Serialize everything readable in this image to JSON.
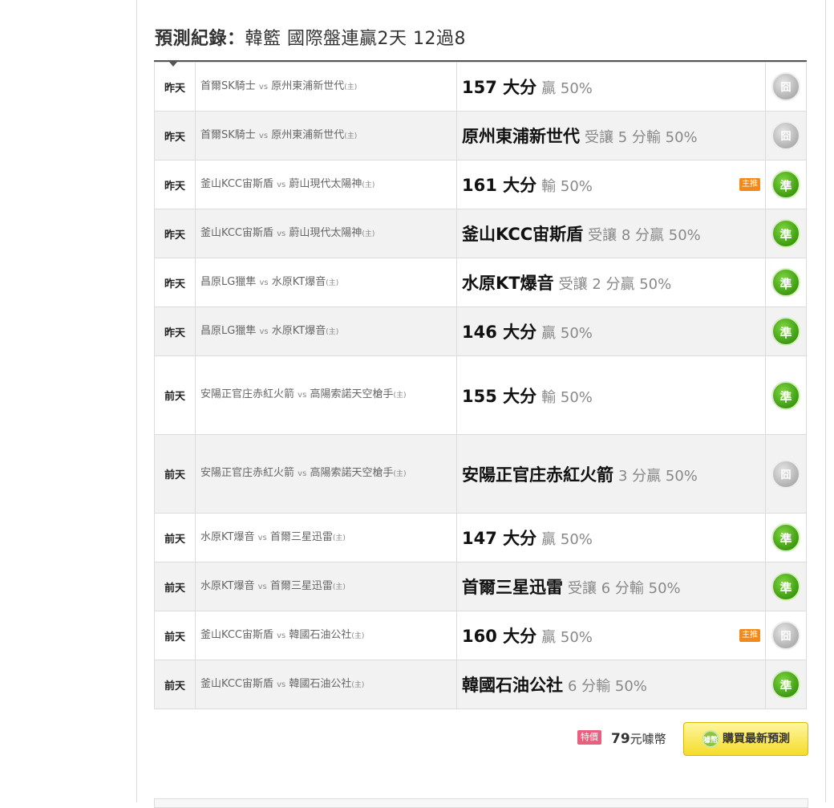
{
  "heading": {
    "prefix": "預測紀錄：",
    "rest": "韓籃 國際盤連贏2天 12過8"
  },
  "rows": [
    {
      "day": "昨天",
      "home": "首爾SK騎士",
      "away": "原州東浦新世代",
      "big": "157 大分",
      "small": "贏 50%",
      "main": false,
      "result": "miss",
      "alt": false,
      "tall": false
    },
    {
      "day": "昨天",
      "home": "首爾SK騎士",
      "away": "原州東浦新世代",
      "big": "原州東浦新世代",
      "small": "受讓 5 分輸 50%",
      "main": false,
      "result": "miss",
      "alt": true,
      "tall": false
    },
    {
      "day": "昨天",
      "home": "釜山KCC宙斯盾",
      "away": "蔚山現代太陽神",
      "big": "161 大分",
      "small": "輸 50%",
      "main": true,
      "result": "win",
      "alt": false,
      "tall": false
    },
    {
      "day": "昨天",
      "home": "釜山KCC宙斯盾",
      "away": "蔚山現代太陽神",
      "big": "釜山KCC宙斯盾",
      "small": "受讓 8 分贏 50%",
      "main": false,
      "result": "win",
      "alt": true,
      "tall": false
    },
    {
      "day": "昨天",
      "home": "昌原LG獵隼",
      "away": "水原KT爆音",
      "big": "水原KT爆音",
      "small": "受讓 2 分贏 50%",
      "main": false,
      "result": "win",
      "alt": false,
      "tall": false
    },
    {
      "day": "昨天",
      "home": "昌原LG獵隼",
      "away": "水原KT爆音",
      "big": "146 大分",
      "small": "贏 50%",
      "main": false,
      "result": "win",
      "alt": true,
      "tall": false
    },
    {
      "day": "前天",
      "home": "安陽正官庄赤紅火箭",
      "away": "高陽索諾天空槍手",
      "big": "155 大分",
      "small": "輸 50%",
      "main": false,
      "result": "win",
      "alt": false,
      "tall": true
    },
    {
      "day": "前天",
      "home": "安陽正官庄赤紅火箭",
      "away": "高陽索諾天空槍手",
      "big": "安陽正官庄赤紅火箭",
      "small": "3 分贏 50%",
      "main": false,
      "result": "miss",
      "alt": true,
      "tall": true
    },
    {
      "day": "前天",
      "home": "水原KT爆音",
      "away": "首爾三星迅雷",
      "big": "147 大分",
      "small": "贏 50%",
      "main": false,
      "result": "win",
      "alt": false,
      "tall": false
    },
    {
      "day": "前天",
      "home": "水原KT爆音",
      "away": "首爾三星迅雷",
      "big": "首爾三星迅雷",
      "small": "受讓 6 分輸 50%",
      "main": false,
      "result": "win",
      "alt": true,
      "tall": false
    },
    {
      "day": "前天",
      "home": "釜山KCC宙斯盾",
      "away": "韓國石油公社",
      "big": "160 大分",
      "small": "贏 50%",
      "main": true,
      "result": "miss",
      "alt": false,
      "tall": false
    },
    {
      "day": "前天",
      "home": "釜山KCC宙斯盾",
      "away": "韓國石油公社",
      "big": "韓國石油公社",
      "small": "6 分輸 50%",
      "main": false,
      "result": "win",
      "alt": true,
      "tall": false
    }
  ],
  "labels": {
    "vs": "vs",
    "host": "(主)",
    "main_tag": "主推",
    "win": "準",
    "miss": "囧"
  },
  "footer": {
    "price_tag": "特價",
    "price_value": "79",
    "price_unit": "元噱幣",
    "buy_label": "購買最新預測",
    "coin_label": "噱幣"
  },
  "colors": {
    "win": "#4caf1f",
    "miss": "#bdbdbd",
    "main_tag": "#f08a1c",
    "buy_button": "#f5dc2a"
  }
}
